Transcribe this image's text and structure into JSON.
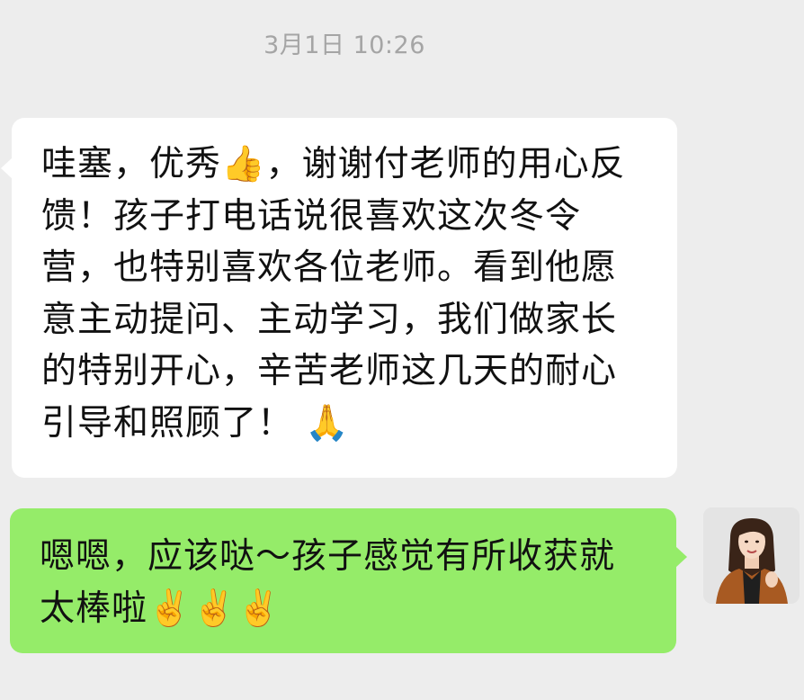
{
  "timestamp": "3月1日 10:26",
  "messages": {
    "incoming": {
      "text_before_thumb": "哇塞，优秀",
      "thumb_emoji": "👍",
      "text_after_thumb": "，谢谢付老师的用心反馈！孩子打电话说很喜欢这次冬令营，也特别喜欢各位老师。看到他愿意主动提问、主动学习，我们做家长的特别开心，辛苦老师这几天的耐心引导和照顾了！",
      "pray_emoji": "🙏"
    },
    "outgoing": {
      "text": "嗯嗯，应该哒～孩子感觉有所收获就太棒啦",
      "victory_emojis": "✌️✌️✌️"
    }
  },
  "colors": {
    "background": "#ededed",
    "incoming_bubble": "#ffffff",
    "outgoing_bubble": "#95ec69",
    "timestamp_text": "#a5a5a5"
  },
  "icons": {
    "avatar": "user-avatar-woman"
  }
}
